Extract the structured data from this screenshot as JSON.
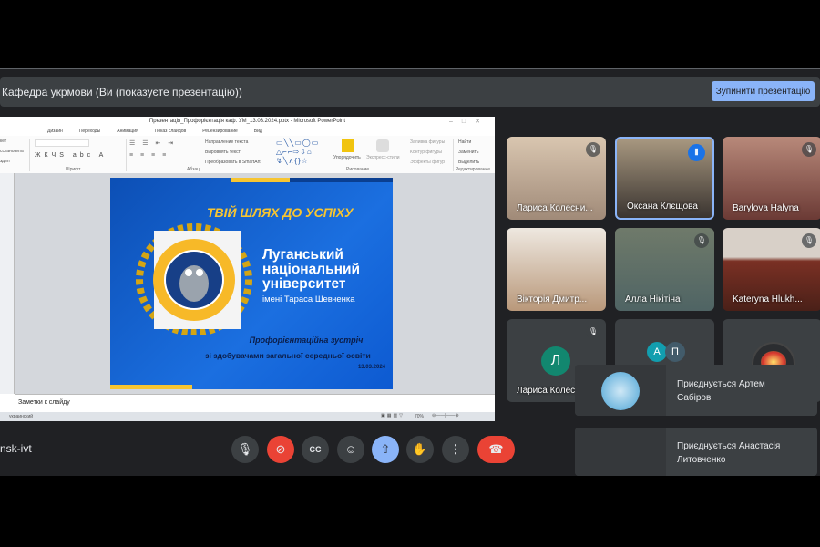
{
  "banner": {
    "text": "Кафедра укрмови (Ви (показуєте презентацію))",
    "stop_button": "Зупинити презентацію"
  },
  "powerpoint": {
    "title": "Презентація_Профорієнтація каф. УМ_13.03.2024.pptx - Microsoft PowerPoint",
    "tabs": [
      "Дизайн",
      "Переходы",
      "Анимация",
      "Показ слайдов",
      "Рецензирование",
      "Вид"
    ],
    "ribbon_groups": [
      "Шрифт",
      "Абзац",
      "Рисование",
      "Редактирование"
    ],
    "ribbon_items": [
      "Направление текста",
      "Выровнять текст",
      "Преобразовать в SmartArt",
      "Упорядочить",
      "Экспресс-стили",
      "Заливка фигуры",
      "Контур фигуры",
      "Эффекты фигур",
      "Найти",
      "Заменить",
      "Выделить"
    ],
    "left_items": [
      "кет",
      "сстановить",
      "здел"
    ],
    "notes_placeholder": "Заметки к слайду",
    "status_language": "украинский",
    "zoom": "70%"
  },
  "slide": {
    "tagline": "ТВІЙ ШЛЯХ ДО УСПІХУ",
    "university_lines": [
      "Луганський",
      "національний",
      "університет"
    ],
    "university_sub": "імені Тараса Шевченка",
    "meeting": "Профорієнтаційна зустріч",
    "audience": "зі здобувачами загальної середньої освіти",
    "date": "13.03.2024"
  },
  "participants": [
    {
      "name": "Лариса Колесни...",
      "muted": true
    },
    {
      "name": "Оксана Клєщова",
      "muted": false,
      "speaking": true
    },
    {
      "name": "Barylova Halyna",
      "muted": true
    },
    {
      "name": "Вікторія Дмитр...",
      "muted": false
    },
    {
      "name": "Алла Нікітіна",
      "muted": true
    },
    {
      "name": "Kateryna Hlukh...",
      "muted": true
    },
    {
      "name": "Лариса Колесникова",
      "muted": true,
      "initial": "Л"
    },
    {
      "name": "",
      "initials": [
        "А",
        "П"
      ]
    },
    {
      "name": ""
    }
  ],
  "toasts": [
    {
      "line1": "Приєднується Артем",
      "line2": "Сабіров"
    },
    {
      "line1": "Приєднується Анастасія",
      "line2": "Литовченко"
    }
  ],
  "meeting_code": "nsk-ivt",
  "colors": {
    "accent": "#8ab4f8",
    "danger": "#ea4335",
    "bg": "#202124"
  }
}
